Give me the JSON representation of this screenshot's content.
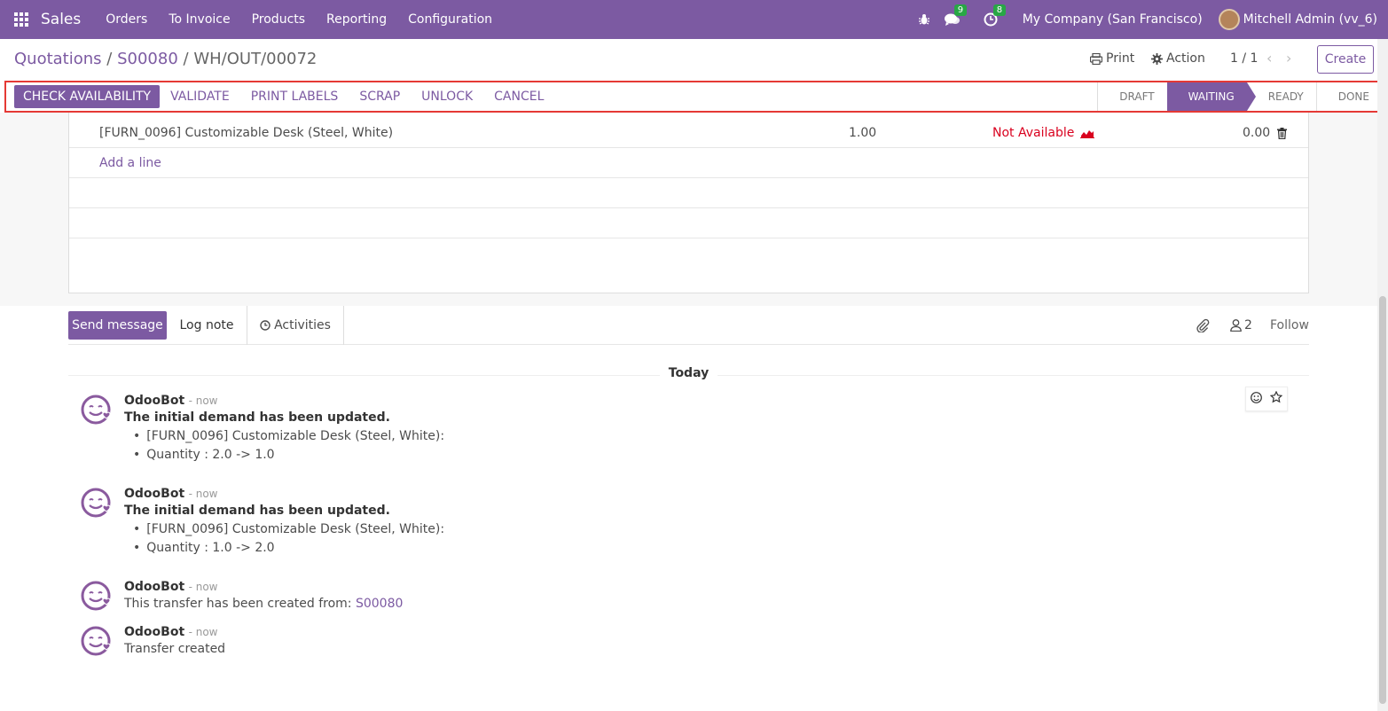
{
  "navbar": {
    "app_name": "Sales",
    "menu": [
      "Orders",
      "To Invoice",
      "Products",
      "Reporting",
      "Configuration"
    ],
    "messages_count": "9",
    "activities_count": "8",
    "company": "My Company (San Francisco)",
    "user": "Mitchell Admin (vv_6)"
  },
  "control_panel": {
    "breadcrumb_1": "Quotations",
    "breadcrumb_2": "S00080",
    "breadcrumb_current": "WH/OUT/00072",
    "separator": "/",
    "print_label": "Print",
    "action_label": "Action",
    "pager": "1 / 1",
    "create_label": "Create"
  },
  "statusbar": {
    "buttons": {
      "check_availability": "CHECK AVAILABILITY",
      "validate": "VALIDATE",
      "print_labels": "PRINT LABELS",
      "scrap": "SCRAP",
      "unlock": "UNLOCK",
      "cancel": "CANCEL"
    },
    "stages": [
      "DRAFT",
      "WAITING",
      "READY",
      "DONE"
    ],
    "active_stage": "WAITING"
  },
  "operations": {
    "rows": [
      {
        "product": "[FURN_0096] Customizable Desk (Steel, White)",
        "demand": "1.00",
        "availability": "Not Available",
        "quantity_done": "0.00"
      }
    ],
    "add_line": "Add a line"
  },
  "chatter": {
    "send_message": "Send message",
    "log_note": "Log note",
    "activities": "Activities",
    "followers_count": "2",
    "follow": "Follow",
    "date_separator": "Today",
    "messages": [
      {
        "author": "OdooBot",
        "date": "- now",
        "title": "The initial demand has been updated.",
        "items": [
          "[FURN_0096] Customizable Desk (Steel, White):",
          "Quantity : 2.0 -> 1.0"
        ]
      },
      {
        "author": "OdooBot",
        "date": "- now",
        "title": "The initial demand has been updated.",
        "items": [
          "[FURN_0096] Customizable Desk (Steel, White):",
          "Quantity : 1.0 -> 2.0"
        ]
      },
      {
        "author": "OdooBot",
        "date": "- now",
        "text": "This transfer has been created from:",
        "link": "S00080"
      },
      {
        "author": "OdooBot",
        "date": "- now",
        "text": "Transfer created"
      }
    ]
  },
  "colors": {
    "brand": "#7c5aa2",
    "danger": "#d9001e",
    "badge": "#28a745",
    "highlight_border": "#e53935"
  },
  "icons": {
    "apps": "apps-grid-icon",
    "debug": "bug-icon",
    "messages": "chat-icon",
    "activities": "clock-icon",
    "print": "printer-icon",
    "action": "gear-icon",
    "forecast": "area-chart-icon",
    "delete": "trash-icon",
    "attachment": "paperclip-icon",
    "followers": "user-icon",
    "reaction": "smile-icon",
    "star": "star-icon"
  }
}
